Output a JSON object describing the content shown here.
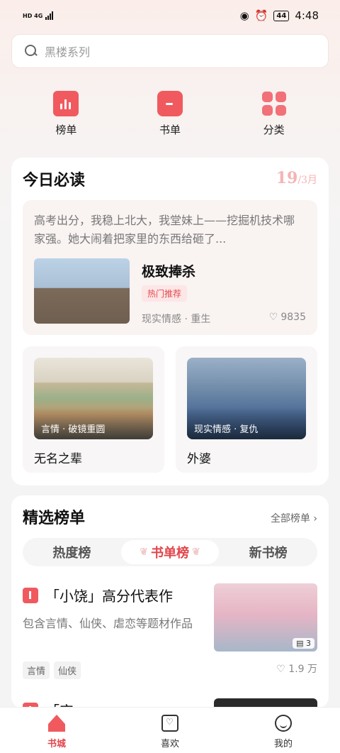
{
  "status_bar": {
    "left_top": "HD 4G",
    "left_bottom": "HD 4G",
    "battery": "44",
    "time": "4:48"
  },
  "search": {
    "placeholder": "黑楼系列"
  },
  "quick_nav": [
    {
      "label": "榜单",
      "icon": "chart-icon"
    },
    {
      "label": "书单",
      "icon": "book-icon"
    },
    {
      "label": "分类",
      "icon": "category-icon"
    }
  ],
  "today": {
    "title": "今日必读",
    "date_day": "19",
    "date_month": "/3月",
    "hero": {
      "excerpt": "高考出分，我稳上北大，我堂妹上——挖掘机技术哪家强。她大闹着把家里的东西给砸了...",
      "title": "极致捧杀",
      "badge": "热门推荐",
      "tags": "现实情感 · 重生",
      "likes": "9835"
    },
    "minis": [
      {
        "caption": "言情 · 破镜重圆",
        "title": "无名之辈"
      },
      {
        "caption": "现实情感 · 复仇",
        "title": "外婆"
      }
    ]
  },
  "ranking": {
    "title": "精选榜单",
    "more": "全部榜单 ›",
    "tabs": [
      "热度榜",
      "书单榜",
      "新书榜"
    ],
    "items": [
      {
        "title": "「小饶」高分代表作",
        "desc": "包含言情、仙侠、虐恋等题材作品",
        "chips": [
          "言情",
          "仙侠"
        ],
        "stack": "3",
        "likes": "1.9 万"
      },
      {
        "title": "「宋」...",
        "desc": "",
        "chips": [],
        "stack": "",
        "likes": ""
      }
    ]
  },
  "bottom_nav": [
    {
      "label": "书城",
      "icon": "home-icon",
      "active": true
    },
    {
      "label": "喜欢",
      "icon": "heart-icon",
      "active": false
    },
    {
      "label": "我的",
      "icon": "smile-icon",
      "active": false
    }
  ],
  "colors": {
    "accent": "#e2454b",
    "icon_red": "#f05a5f",
    "date_pink": "#f5b3b6"
  }
}
